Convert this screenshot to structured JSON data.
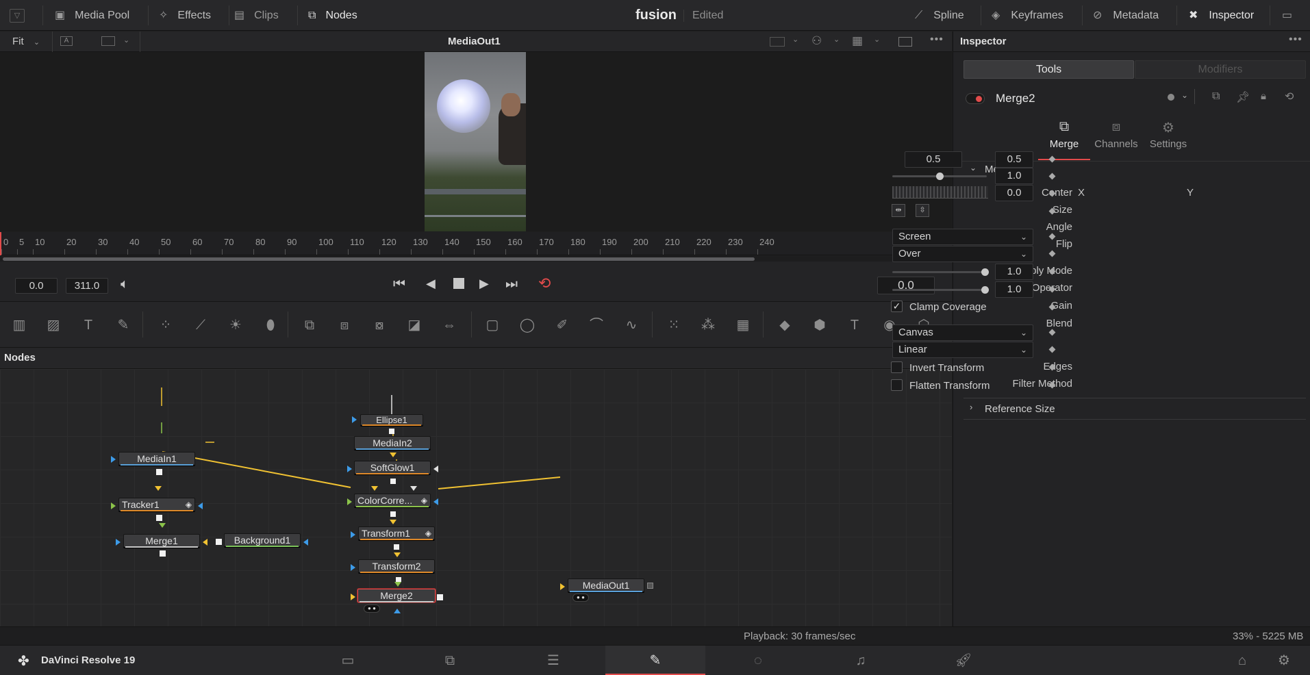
{
  "topbar": {
    "media_pool": "Media Pool",
    "effects": "Effects",
    "clips": "Clips",
    "nodes": "Nodes",
    "project_name": "fusion",
    "project_status": "Edited",
    "spline": "Spline",
    "keyframes": "Keyframes",
    "metadata": "Metadata",
    "inspector": "Inspector"
  },
  "viewer": {
    "zoom": "Fit",
    "title": "MediaOut1",
    "a_label": "A"
  },
  "ruler": {
    "ticks": [
      "0",
      "5",
      "10",
      "20",
      "30",
      "40",
      "50",
      "60",
      "70",
      "80",
      "90",
      "100",
      "110",
      "120",
      "130",
      "140",
      "150",
      "160",
      "170",
      "180",
      "190",
      "200",
      "210",
      "220",
      "230",
      "240"
    ]
  },
  "transport": {
    "start_frame": "0.0",
    "end_frame": "311.0",
    "current_time": "0.0"
  },
  "nodes_panel": {
    "title": "Nodes",
    "nodes": {
      "mediain1": "MediaIn1",
      "tracker1": "Tracker1",
      "merge1": "Merge1",
      "background1": "Background1",
      "ellipse1": "Ellipse1",
      "mediain2": "MediaIn2",
      "softglow1": "SoftGlow1",
      "colorcorrector": "ColorCorre...",
      "transform1": "Transform1",
      "transform2": "Transform2",
      "merge2": "Merge2",
      "mediaout1": "MediaOut1"
    }
  },
  "inspector": {
    "title": "Inspector",
    "tab_tools": "Tools",
    "tab_modifiers": "Modifiers",
    "node_name": "Merge2",
    "subtabs": [
      "Merge",
      "Channels",
      "Settings"
    ],
    "section_merge": "Merge",
    "center_label": "Center",
    "x_label": "X",
    "center_x": "0.5",
    "y_label": "Y",
    "center_y": "0.5",
    "size_label": "Size",
    "size_value": "1.0",
    "size_fraction": 0.5,
    "angle_label": "Angle",
    "angle_value": "0.0",
    "flip_label": "Flip",
    "apply_mode_label": "Apply Mode",
    "apply_mode": "Screen",
    "operator_label": "Operator",
    "operator": "Over",
    "gain_label": "Gain",
    "gain_value": "1.0",
    "blend_label": "Blend",
    "blend_value": "1.0",
    "clamp_coverage": "Clamp Coverage",
    "edges_label": "Edges",
    "edges": "Canvas",
    "filter_method_label": "Filter Method",
    "filter_method": "Linear",
    "invert_transform": "Invert Transform",
    "flatten_transform": "Flatten Transform",
    "section_reference_size": "Reference Size"
  },
  "status": {
    "playback": "Playback: 30 frames/sec",
    "memory": "33% - 5225 MB"
  },
  "bottombar": {
    "app_name": "DaVinci Resolve 19"
  },
  "colors": {
    "accent_red": "#e24b4b",
    "connection_yellow": "#f1c232",
    "input_blue": "#3d9be8"
  }
}
